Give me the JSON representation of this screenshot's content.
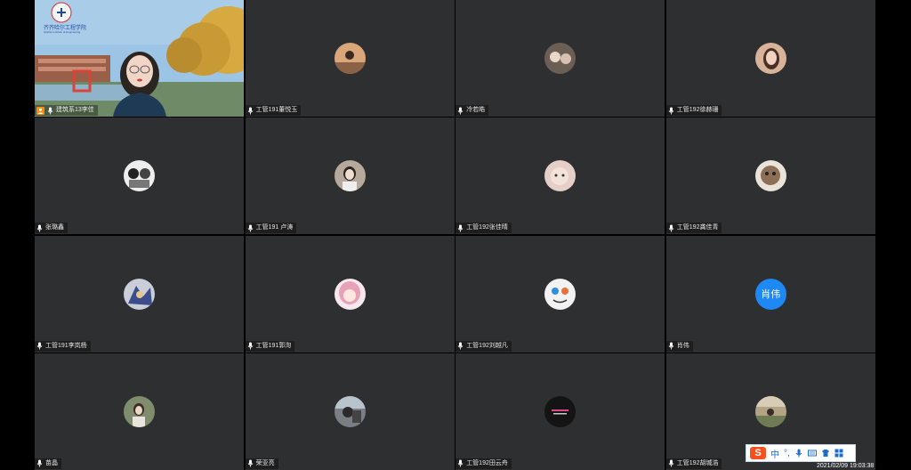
{
  "host": {
    "name": "建筑系13李佳",
    "school_logo_text": "齐齐哈尔工程学院",
    "school_logo_subtext": "Qiqihar Institute of Engineering"
  },
  "participants": [
    {
      "name": "工管191董悦玉",
      "avatar_color": "#d9a77a"
    },
    {
      "name": "冷若皓",
      "avatar_color": "#6b5e55"
    },
    {
      "name": "工管192徐赫珊",
      "avatar_color": "#d8b39a"
    },
    {
      "name": "张璐鑫",
      "avatar_color": "#eeeeee"
    },
    {
      "name": "工管191 卢涛",
      "avatar_color": "#b7a99b"
    },
    {
      "name": "工管192张佳晴",
      "avatar_color": "#e6cfc6"
    },
    {
      "name": "工管192龚佳青",
      "avatar_color": "#8d6f57"
    },
    {
      "name": "工管191李岚杨",
      "avatar_color": "#8d8fb6"
    },
    {
      "name": "工管191郭洵",
      "avatar_color": "#e7b2c4"
    },
    {
      "name": "工管192刘越凡",
      "avatar_color": "#f2f2f2"
    },
    {
      "name": "肖伟",
      "avatar_color": "#1e88f5",
      "initials": "肖伟"
    },
    {
      "name": "苗晶",
      "avatar_color": "#7f8d6e"
    },
    {
      "name": "荣亚亮",
      "avatar_color": "#7a7f86"
    },
    {
      "name": "工管192田云舟",
      "avatar_color": "#141414"
    },
    {
      "name": "工管192胡城浩",
      "avatar_color": "#b3a584"
    }
  ],
  "ime": {
    "mode": "中",
    "punct": "°,"
  },
  "clock": "2021/02/09 19:03:38"
}
